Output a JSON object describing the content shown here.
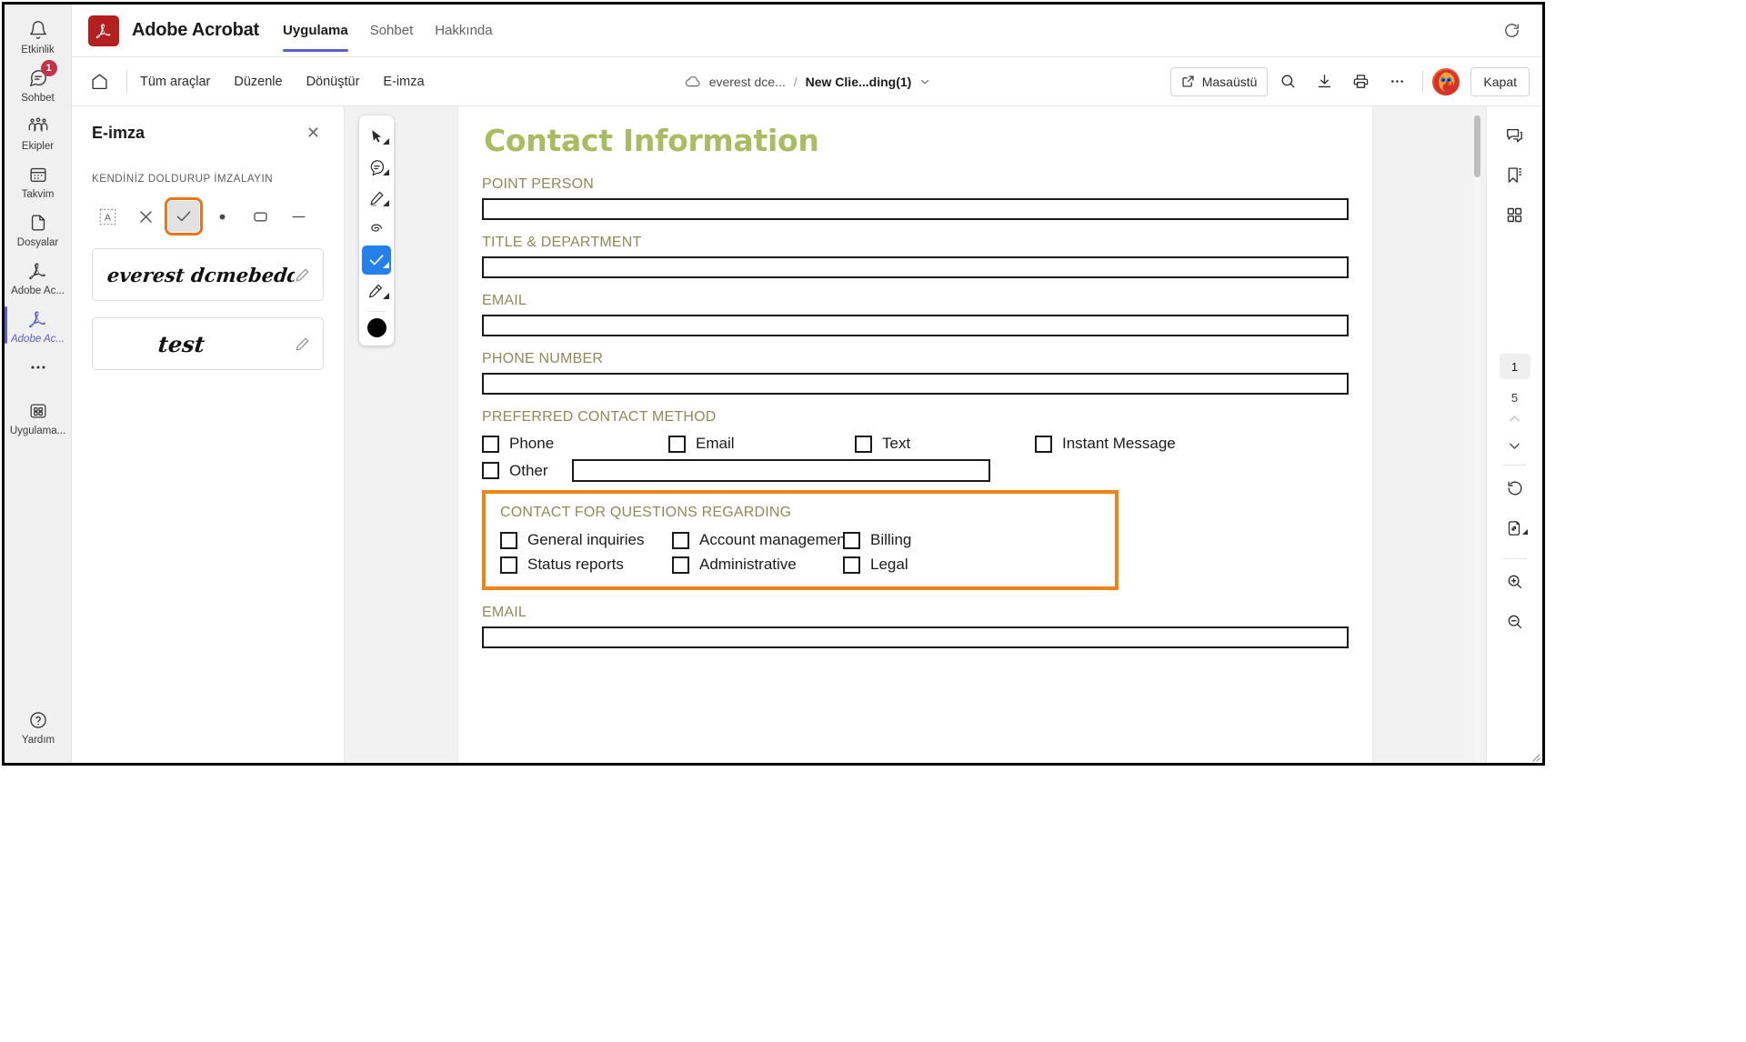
{
  "teams_rail": {
    "items": [
      {
        "label": "Etkinlik",
        "icon": "bell-icon",
        "badge": null,
        "active": false
      },
      {
        "label": "Sohbet",
        "icon": "chat-icon",
        "badge": "1",
        "active": false
      },
      {
        "label": "Ekipler",
        "icon": "teams-icon",
        "badge": null,
        "active": false
      },
      {
        "label": "Takvim",
        "icon": "calendar-icon",
        "badge": null,
        "active": false
      },
      {
        "label": "Dosyalar",
        "icon": "file-icon",
        "badge": null,
        "active": false
      },
      {
        "label": "Adobe Ac...",
        "icon": "adobe-acrobat-icon",
        "badge": null,
        "active": false
      },
      {
        "label": "Adobe Ac...",
        "icon": "adobe-acrobat-icon",
        "badge": null,
        "active": true
      },
      {
        "label": "",
        "icon": "more-options-icon",
        "badge": null,
        "active": false
      },
      {
        "label": "Uygulama...",
        "icon": "apps-grid-icon",
        "badge": null,
        "active": false
      }
    ],
    "help_label": "Yardım",
    "help_icon": "help-circle-icon",
    "accent_color": "#5b5fc7",
    "badge_color": "#c4314b"
  },
  "titlebar": {
    "app_title": "Adobe Acrobat",
    "logo_icon": "adobe-acrobat-logo",
    "logo_color": "#b5201f",
    "tabs": [
      {
        "label": "Uygulama",
        "active": true
      },
      {
        "label": "Sohbet",
        "active": false
      },
      {
        "label": "Hakkında",
        "active": false
      }
    ],
    "refresh_icon": "refresh-icon"
  },
  "toolbar": {
    "home_icon": "home-icon",
    "menus": [
      "Tüm araçlar",
      "Düzenle",
      "Dönüştür",
      "E-imza"
    ],
    "breadcrumb": {
      "cloud_icon": "cloud-icon",
      "root": "everest dce...",
      "separator": "/",
      "file": "New Clie...ding(1)",
      "caret_icon": "chevron-down-icon"
    },
    "desktop_button": {
      "label": "Masaüstü",
      "icon": "open-external-icon"
    },
    "icons": [
      {
        "name": "search-icon"
      },
      {
        "name": "download-icon"
      },
      {
        "name": "print-icon"
      },
      {
        "name": "more-options-icon"
      }
    ],
    "avatar": "user-avatar",
    "close_label": "Kapat"
  },
  "esign_panel": {
    "title": "E-imza",
    "close_icon": "close-icon",
    "subtitle": "KENDİNİZ DOLDURUP İMZALAYIN",
    "tools": [
      {
        "name": "text-field-tool",
        "glyph": "A",
        "selected": false
      },
      {
        "name": "cross-mark-tool",
        "glyph": "✕",
        "selected": false
      },
      {
        "name": "check-mark-tool",
        "glyph": "✓",
        "selected": true
      },
      {
        "name": "dot-tool",
        "glyph": "●",
        "selected": false
      },
      {
        "name": "rectangle-tool",
        "glyph": "▭",
        "selected": false
      },
      {
        "name": "line-tool",
        "glyph": "—",
        "selected": false
      }
    ],
    "selection_outline_color": "#e8761a",
    "signatures": [
      {
        "text": "everest dcmebedd",
        "edit_icon": "pencil-icon"
      },
      {
        "text": "test",
        "edit_icon": "pencil-icon"
      }
    ]
  },
  "float_toolbar": {
    "buttons": [
      {
        "name": "select-tool",
        "active": false,
        "has_caret": true
      },
      {
        "name": "comment-tool",
        "active": false,
        "has_caret": true
      },
      {
        "name": "highlighter-tool",
        "active": false,
        "has_caret": true
      },
      {
        "name": "freehand-tool",
        "active": false,
        "has_caret": false
      },
      {
        "name": "check-mark-tool",
        "active": true,
        "has_caret": true
      },
      {
        "name": "signature-tool",
        "active": false,
        "has_caret": true
      }
    ],
    "color_swatch": "#000000",
    "active_color": "#2680eb"
  },
  "document": {
    "heading": "Contact Information",
    "heading_color": "#a9bd60",
    "label_color": "#8c8c5a",
    "fields": [
      {
        "label": "POINT PERSON",
        "value": ""
      },
      {
        "label": "TITLE & DEPARTMENT",
        "value": ""
      },
      {
        "label": "EMAIL",
        "value": ""
      },
      {
        "label": "PHONE NUMBER",
        "value": ""
      }
    ],
    "preferred_contact": {
      "label": "PREFERRED CONTACT METHOD",
      "options": [
        {
          "label": "Phone",
          "checked": false
        },
        {
          "label": "Email",
          "checked": false
        },
        {
          "label": "Text",
          "checked": false
        },
        {
          "label": "Instant Message",
          "checked": false
        }
      ],
      "other_label": "Other",
      "other_value": "",
      "other_checked": false
    },
    "questions_section": {
      "label": "CONTACT FOR QUESTIONS REGARDING",
      "highlight_color": "#ee8413",
      "options_col1": [
        {
          "label": "General inquiries",
          "checked": false
        },
        {
          "label": "Status reports",
          "checked": false
        }
      ],
      "options_col2": [
        {
          "label": "Account management",
          "checked": false
        },
        {
          "label": "Administrative",
          "checked": false
        }
      ],
      "options_col3": [
        {
          "label": "Billing",
          "checked": false
        },
        {
          "label": "Legal",
          "checked": false
        }
      ]
    },
    "bottom_field": {
      "label": "EMAIL",
      "value": ""
    }
  },
  "right_rail": {
    "top_icons": [
      {
        "name": "comments-icon"
      },
      {
        "name": "bookmark-icon"
      },
      {
        "name": "thumbnails-icon"
      }
    ],
    "page_current": "1",
    "page_total": "5",
    "prev_icon": "chevron-up-icon",
    "next_icon": "chevron-down-icon",
    "bottom_icons": [
      {
        "name": "rotate-icon"
      },
      {
        "name": "fit-page-icon"
      },
      {
        "name": "zoom-in-icon"
      },
      {
        "name": "zoom-out-icon"
      }
    ]
  }
}
